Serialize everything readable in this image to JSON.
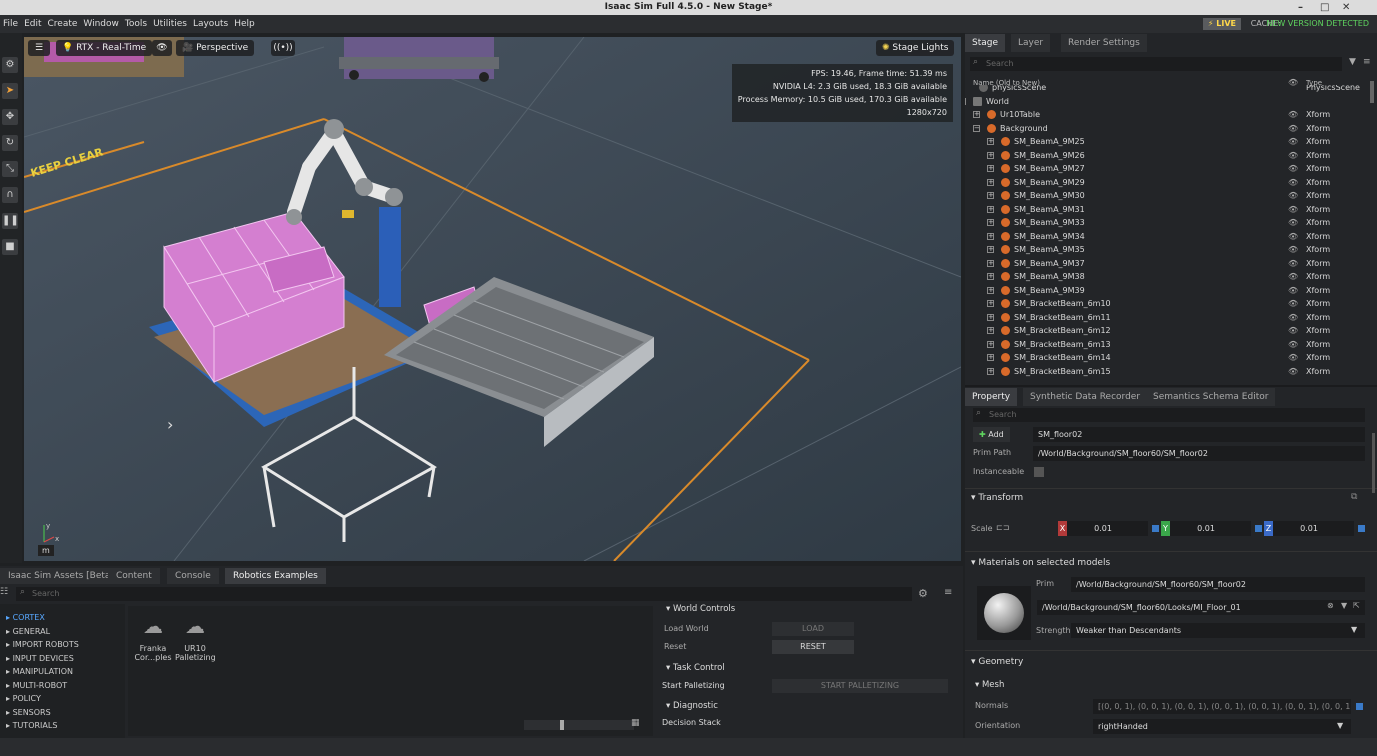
{
  "window": {
    "title": "Isaac Sim Full 4.5.0 - New Stage*",
    "minimize": "–",
    "maximize": "□",
    "close": "✕"
  },
  "menu": [
    "File",
    "Edit",
    "Create",
    "Window",
    "Tools",
    "Utilities",
    "Layouts",
    "Help"
  ],
  "status": {
    "live": "⚡ LIVE",
    "cache": "CACHE:",
    "new_version": "NEW VERSION DETECTED"
  },
  "viewport": {
    "renderer": "RTX - Real-Time",
    "camera": "Perspective",
    "lights": "Stage Lights",
    "stats": [
      "FPS: 19.46, Frame time: 51.39 ms",
      "NVIDIA L4: 2.3 GiB used, 18.3 GiB available",
      "Process Memory: 10.5 GiB used, 170.3 GiB available",
      "1280x720"
    ],
    "floor_marking": "KEEP CLEAR",
    "unit": "m",
    "axis_x": "x",
    "axis_y": "y"
  },
  "stage": {
    "tabs": [
      "Stage",
      "Layer",
      "Render Settings"
    ],
    "search_placeholder": "Search",
    "col_name": "Name (Old to New)",
    "col_type": "Type",
    "rows": [
      {
        "name": "physicsScene",
        "type": "PhysicsScene"
      },
      {
        "name": "World",
        "type": ""
      },
      {
        "name": "Ur10Table",
        "type": "Xform"
      },
      {
        "name": "Background",
        "type": "Xform"
      },
      {
        "name": "SM_BeamA_9M25",
        "type": "Xform"
      },
      {
        "name": "SM_BeamA_9M26",
        "type": "Xform"
      },
      {
        "name": "SM_BeamA_9M27",
        "type": "Xform"
      },
      {
        "name": "SM_BeamA_9M29",
        "type": "Xform"
      },
      {
        "name": "SM_BeamA_9M30",
        "type": "Xform"
      },
      {
        "name": "SM_BeamA_9M31",
        "type": "Xform"
      },
      {
        "name": "SM_BeamA_9M33",
        "type": "Xform"
      },
      {
        "name": "SM_BeamA_9M34",
        "type": "Xform"
      },
      {
        "name": "SM_BeamA_9M35",
        "type": "Xform"
      },
      {
        "name": "SM_BeamA_9M37",
        "type": "Xform"
      },
      {
        "name": "SM_BeamA_9M38",
        "type": "Xform"
      },
      {
        "name": "SM_BeamA_9M39",
        "type": "Xform"
      },
      {
        "name": "SM_BracketBeam_6m10",
        "type": "Xform"
      },
      {
        "name": "SM_BracketBeam_6m11",
        "type": "Xform"
      },
      {
        "name": "SM_BracketBeam_6m12",
        "type": "Xform"
      },
      {
        "name": "SM_BracketBeam_6m13",
        "type": "Xform"
      },
      {
        "name": "SM_BracketBeam_6m14",
        "type": "Xform"
      },
      {
        "name": "SM_BracketBeam_6m15",
        "type": "Xform"
      }
    ]
  },
  "property": {
    "tabs": [
      "Property",
      "Synthetic Data Recorder",
      "Semantics Schema Editor"
    ],
    "search_placeholder": "Search",
    "add_label": "Add",
    "prim_name": "SM_floor02",
    "prim_path_label": "Prim Path",
    "prim_path": "/World/Background/SM_floor60/SM_floor02",
    "instanceable_label": "Instanceable",
    "transform_label": "Transform",
    "scale_label": "Scale",
    "scale": {
      "x": "0.01",
      "y": "0.01",
      "z": "0.01"
    },
    "materials_label": "Materials on selected models",
    "prim_label": "Prim",
    "material_prim": "/World/Background/SM_floor60/SM_floor02",
    "material_path": "/World/Background/SM_floor60/Looks/MI_Floor_01",
    "strength_label": "Strength",
    "strength_value": "Weaker than Descendants",
    "geometry_label": "Geometry",
    "mesh_label": "Mesh",
    "normals_label": "Normals",
    "normals_value": "[(0, 0, 1), (0, 0, 1), (0, 0, 1), (0, 0, 1), (0, 0, 1), (0, 0, 1), (0, 0, 1), (0, 0, 1",
    "orientation_label": "Orientation",
    "orientation_value": "rightHanded"
  },
  "bottom": {
    "tabs": [
      "Isaac Sim Assets [Beta]",
      "Content",
      "Console",
      "Robotics Examples"
    ],
    "search_placeholder": "Search",
    "categories": [
      "CORTEX",
      "GENERAL",
      "IMPORT ROBOTS",
      "INPUT DEVICES",
      "MANIPULATION",
      "MULTI-ROBOT",
      "POLICY",
      "SENSORS",
      "TUTORIALS"
    ],
    "examples": [
      {
        "line1": "Franka",
        "line2": "Cor...ples"
      },
      {
        "line1": "UR10",
        "line2": "Palletizing"
      }
    ],
    "world_controls": "World Controls",
    "load_world": "Load World",
    "load_btn": "LOAD",
    "reset": "Reset",
    "reset_btn": "RESET",
    "task_control": "Task Control",
    "start_palletizing": "Start Palletizing",
    "start_btn": "START PALLETIZING",
    "diagnostic": "Diagnostic",
    "decision_stack": "Decision Stack"
  }
}
